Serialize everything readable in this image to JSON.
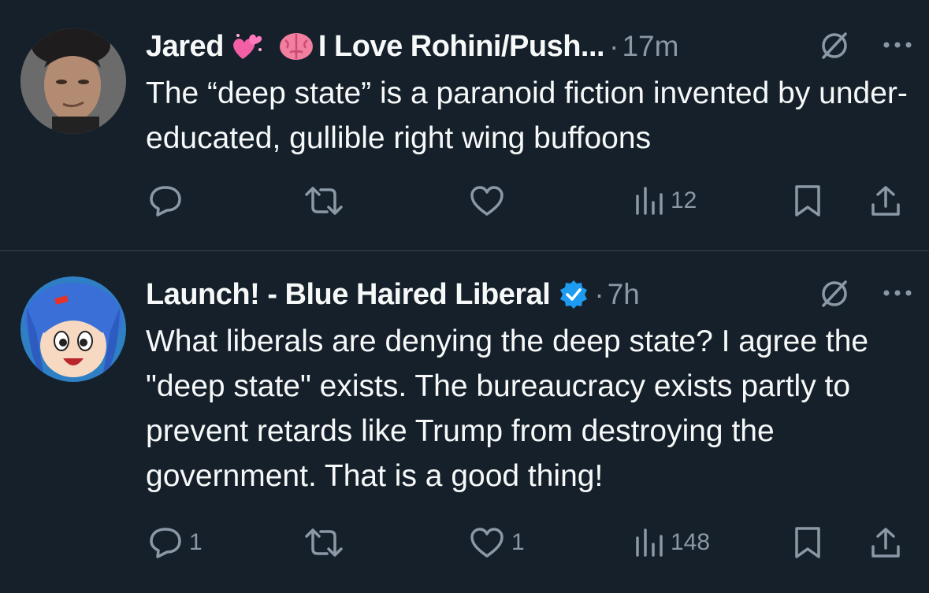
{
  "tweets": [
    {
      "name": "Jared",
      "name_suffix": "I Love Rohini/Push...",
      "separator": "·",
      "time": "17m",
      "text": "The “deep state” is a paranoid fiction invented by under-educated, gullible right wing buffoons",
      "reply_count": "",
      "retweet_count": "",
      "like_count": "",
      "view_count": "12"
    },
    {
      "name": "Launch! - Blue Haired Liberal",
      "verified": true,
      "separator": "·",
      "time": "7h",
      "text": "What liberals are denying the deep state? I agree the \"deep state\" exists. The bureaucracy exists partly to prevent retards like Trump from destroying the government. That is a good thing!",
      "reply_count": "1",
      "retweet_count": "",
      "like_count": "1",
      "view_count": "148"
    }
  ],
  "icons": {
    "header": [
      "grok-slash-icon",
      "more-icon"
    ],
    "actions": [
      "reply-icon",
      "retweet-icon",
      "like-icon",
      "views-icon",
      "bookmark-icon",
      "share-icon"
    ],
    "emoji_1": "sparkling-heart-emoji",
    "emoji_2": "brain-emoji",
    "verified": "verified-badge-icon"
  },
  "colors": {
    "background": "#15202b",
    "text": "#f7f9f9",
    "muted": "#8b98a5",
    "divider": "#38444d",
    "verified": "#1d9bf0"
  }
}
